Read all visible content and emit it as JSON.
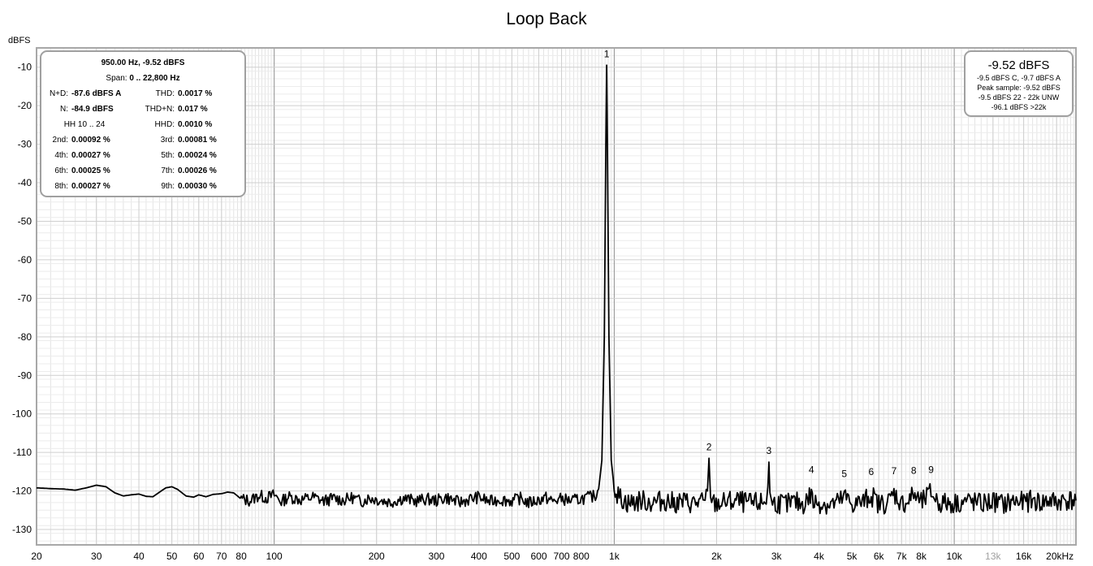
{
  "title": "Loop Back",
  "stats_panel": {
    "header": "950.00 Hz, -9.52 dBFS",
    "span_label": "Span:",
    "span_value": "0 .. 22,800 Hz",
    "rows": [
      {
        "l1": "N+D:",
        "v1": "-87.6 dBFS A",
        "l2": "THD:",
        "v2": "0.0017 %"
      },
      {
        "l1": "N:",
        "v1": "-84.9 dBFS",
        "l2": "THD+N:",
        "v2": "0.017 %"
      },
      {
        "l1": "HH 10 .. 24",
        "v1": "",
        "l2": "HHD:",
        "v2": "0.0010 %"
      },
      {
        "l1": "2nd:",
        "v1": "0.00092 %",
        "l2": "3rd:",
        "v2": "0.00081 %"
      },
      {
        "l1": "4th:",
        "v1": "0.00027 %",
        "l2": "5th:",
        "v2": "0.00024 %"
      },
      {
        "l1": "6th:",
        "v1": "0.00025 %",
        "l2": "7th:",
        "v2": "0.00026 %"
      },
      {
        "l1": "8th:",
        "v1": "0.00027 %",
        "l2": "9th:",
        "v2": "0.00030 %"
      }
    ]
  },
  "level_panel": {
    "main": "-9.52 dBFS",
    "lines": [
      "-9.5 dBFS C, -9.7 dBFS A",
      "Peak sample: -9.52 dBFS",
      "-9.5 dBFS 22 - 22k UNW",
      "-96.1 dBFS >22k"
    ]
  },
  "chart_data": {
    "type": "line",
    "title": "Loop Back",
    "ylabel": "dBFS",
    "xlabel": "",
    "x_scale": "log",
    "xlim": [
      20,
      22800
    ],
    "ylim": [
      -134,
      -5
    ],
    "grid": true,
    "x_ticks": [
      {
        "v": 20,
        "t": "20"
      },
      {
        "v": 30,
        "t": "30"
      },
      {
        "v": 40,
        "t": "40"
      },
      {
        "v": 50,
        "t": "50"
      },
      {
        "v": 60,
        "t": "60"
      },
      {
        "v": 70,
        "t": "70"
      },
      {
        "v": 80,
        "t": "80"
      },
      {
        "v": 100,
        "t": "100"
      },
      {
        "v": 200,
        "t": "200"
      },
      {
        "v": 300,
        "t": "300"
      },
      {
        "v": 400,
        "t": "400"
      },
      {
        "v": 500,
        "t": "500"
      },
      {
        "v": 600,
        "t": "600"
      },
      {
        "v": 700,
        "t": "700"
      },
      {
        "v": 800,
        "t": "800"
      },
      {
        "v": 1000,
        "t": "1k"
      },
      {
        "v": 2000,
        "t": "2k"
      },
      {
        "v": 3000,
        "t": "3k"
      },
      {
        "v": 4000,
        "t": "4k"
      },
      {
        "v": 5000,
        "t": "5k"
      },
      {
        "v": 6000,
        "t": "6k"
      },
      {
        "v": 7000,
        "t": "7k"
      },
      {
        "v": 8000,
        "t": "8k"
      },
      {
        "v": 10000,
        "t": "10k"
      },
      {
        "v": 13000,
        "t": "13k",
        "muted": true
      },
      {
        "v": 16000,
        "t": "16k"
      },
      {
        "v": 20000,
        "t": "20kHz"
      }
    ],
    "y_ticks": [
      -10,
      -20,
      -30,
      -40,
      -50,
      -60,
      -70,
      -80,
      -90,
      -100,
      -110,
      -120,
      -130
    ],
    "harmonic_markers": [
      {
        "n": "1",
        "freq": 950,
        "level": -9.5
      },
      {
        "n": "2",
        "freq": 1900,
        "level": -111.5
      },
      {
        "n": "3",
        "freq": 2850,
        "level": -112.5
      },
      {
        "n": "4",
        "freq": 3800,
        "level": -117.5
      },
      {
        "n": "5",
        "freq": 4750,
        "level": -118.5
      },
      {
        "n": "6",
        "freq": 5700,
        "level": -118
      },
      {
        "n": "7",
        "freq": 6650,
        "level": -117.8
      },
      {
        "n": "8",
        "freq": 7600,
        "level": -117.7
      },
      {
        "n": "9",
        "freq": 8550,
        "level": -117.5
      }
    ],
    "series": [
      {
        "line_color": "#000000",
        "points": [
          [
            20,
            -119.2
          ],
          [
            22,
            -119.4
          ],
          [
            24,
            -119.5
          ],
          [
            26,
            -119.8
          ],
          [
            28,
            -119.2
          ],
          [
            30,
            -118.5
          ],
          [
            32,
            -118.9
          ],
          [
            34,
            -120.5
          ],
          [
            36,
            -121.3
          ],
          [
            38,
            -121.0
          ],
          [
            40,
            -120.8
          ],
          [
            42,
            -121.4
          ],
          [
            44,
            -121.5
          ],
          [
            46,
            -120.3
          ],
          [
            48,
            -119.2
          ],
          [
            50,
            -118.9
          ],
          [
            52,
            -119.6
          ],
          [
            55,
            -121.3
          ],
          [
            58,
            -121.6
          ],
          [
            60,
            -121.0
          ],
          [
            63,
            -121.5
          ],
          [
            66,
            -120.9
          ],
          [
            70,
            -120.7
          ],
          [
            73,
            -120.3
          ],
          [
            76,
            -120.5
          ],
          [
            80,
            -122.1
          ],
          [
            85,
            -122.5
          ],
          [
            90,
            -121.2
          ],
          [
            95,
            -121.8
          ],
          [
            100,
            -121.0
          ],
          [
            105,
            -122.8
          ],
          [
            110,
            -121.5
          ],
          [
            120,
            -122.3
          ],
          [
            130,
            -121.6
          ],
          [
            140,
            -122.6
          ],
          [
            150,
            -121.9
          ],
          [
            160,
            -122.4
          ],
          [
            170,
            -121.7
          ],
          [
            180,
            -122.8
          ],
          [
            190,
            -121.8
          ],
          [
            200,
            -122.2
          ],
          [
            220,
            -122.9
          ],
          [
            240,
            -121.9
          ],
          [
            260,
            -122.6
          ],
          [
            280,
            -122.1
          ],
          [
            300,
            -122.5
          ],
          [
            320,
            -121.7
          ],
          [
            350,
            -123.0
          ],
          [
            380,
            -122.0
          ],
          [
            400,
            -121.6
          ],
          [
            430,
            -122.8
          ],
          [
            460,
            -122.2
          ],
          [
            500,
            -122.6
          ],
          [
            530,
            -121.9
          ],
          [
            560,
            -123.1
          ],
          [
            600,
            -122.3
          ],
          [
            630,
            -121.8
          ],
          [
            660,
            -122.7
          ],
          [
            700,
            -122.0
          ],
          [
            750,
            -122.6
          ],
          [
            800,
            -122.0
          ],
          [
            850,
            -121.6
          ],
          [
            880,
            -121.2
          ],
          [
            900,
            -119.5
          ],
          [
            920,
            -112.0
          ],
          [
            935,
            -80.0
          ],
          [
            945,
            -30.0
          ],
          [
            950,
            -9.5
          ],
          [
            955,
            -30.0
          ],
          [
            965,
            -80.0
          ],
          [
            980,
            -112.0
          ],
          [
            1000,
            -119.5
          ],
          [
            1020,
            -121.0
          ],
          [
            1050,
            -122.0
          ],
          [
            1100,
            -123.2
          ],
          [
            1200,
            -122.5
          ],
          [
            1300,
            -123.0
          ],
          [
            1400,
            -122.4
          ],
          [
            1500,
            -123.1
          ],
          [
            1600,
            -122.8
          ],
          [
            1700,
            -123.2
          ],
          [
            1800,
            -122.9
          ],
          [
            1850,
            -123.4
          ],
          [
            1880,
            -120.0
          ],
          [
            1900,
            -111.5
          ],
          [
            1920,
            -120.0
          ],
          [
            1950,
            -123.3
          ],
          [
            2100,
            -123.0
          ],
          [
            2300,
            -122.6
          ],
          [
            2500,
            -123.3
          ],
          [
            2700,
            -123.1
          ],
          [
            2800,
            -122.5
          ],
          [
            2830,
            -119.0
          ],
          [
            2850,
            -112.5
          ],
          [
            2870,
            -119.0
          ],
          [
            2900,
            -123.4
          ],
          [
            3000,
            -123.0
          ],
          [
            3200,
            -123.5
          ],
          [
            3400,
            -122.9
          ],
          [
            3600,
            -123.4
          ],
          [
            3800,
            -120.8
          ],
          [
            3850,
            -123.2
          ],
          [
            4000,
            -123.0
          ],
          [
            4300,
            -123.6
          ],
          [
            4600,
            -122.8
          ],
          [
            4750,
            -121.5
          ],
          [
            5000,
            -123.4
          ],
          [
            5400,
            -122.9
          ],
          [
            5700,
            -121.0
          ],
          [
            6000,
            -123.5
          ],
          [
            6400,
            -122.9
          ],
          [
            6650,
            -120.6
          ],
          [
            7000,
            -123.3
          ],
          [
            7300,
            -122.8
          ],
          [
            7600,
            -120.8
          ],
          [
            8000,
            -123.2
          ],
          [
            8550,
            -120.3
          ],
          [
            9000,
            -123.1
          ],
          [
            10000,
            -123.2
          ],
          [
            11000,
            -122.6
          ],
          [
            12000,
            -123.4
          ],
          [
            13000,
            -122.7
          ],
          [
            14000,
            -123.5
          ],
          [
            15000,
            -122.6
          ],
          [
            16000,
            -123.0
          ],
          [
            17000,
            -122.4
          ],
          [
            18000,
            -123.1
          ],
          [
            19000,
            -122.5
          ],
          [
            20000,
            -123.0
          ],
          [
            21000,
            -122.3
          ],
          [
            22800,
            -122.5
          ]
        ]
      }
    ]
  }
}
